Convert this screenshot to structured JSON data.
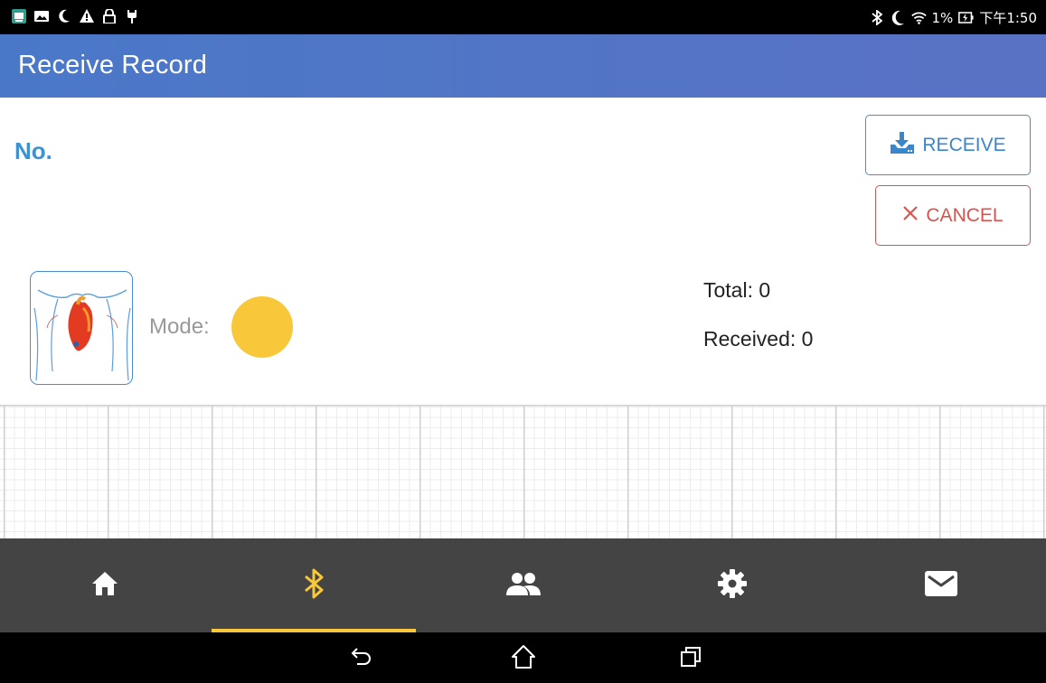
{
  "status_bar": {
    "left_icons": [
      "app-notification-icon",
      "image-icon",
      "moon-icon",
      "warning-icon",
      "lock-icon",
      "usb-icon"
    ],
    "right_icons": [
      "bluetooth-icon",
      "moon-icon",
      "wifi-icon"
    ],
    "battery": "1%",
    "time": "下午1:50"
  },
  "app_bar": {
    "title": "Receive Record"
  },
  "record": {
    "no_label": "No.",
    "mode_label": "Mode:",
    "mode_color": "#f8c83a",
    "total": "Total: 0",
    "received": "Received: 0"
  },
  "actions": {
    "receive_label": "RECEIVE",
    "cancel_label": "CANCEL"
  },
  "bottom_nav": {
    "items": [
      {
        "icon": "home-icon",
        "active": false
      },
      {
        "icon": "bluetooth-icon",
        "active": true
      },
      {
        "icon": "people-icon",
        "active": false
      },
      {
        "icon": "gear-icon",
        "active": false
      },
      {
        "icon": "mail-icon",
        "active": false
      }
    ]
  },
  "system_nav": [
    "back-icon",
    "home-outline-icon",
    "recents-icon"
  ],
  "colors": {
    "accent": "#3d92d3",
    "cancel": "#d9534f",
    "nav_active": "#f8c83a",
    "nav_bg": "#444444"
  }
}
